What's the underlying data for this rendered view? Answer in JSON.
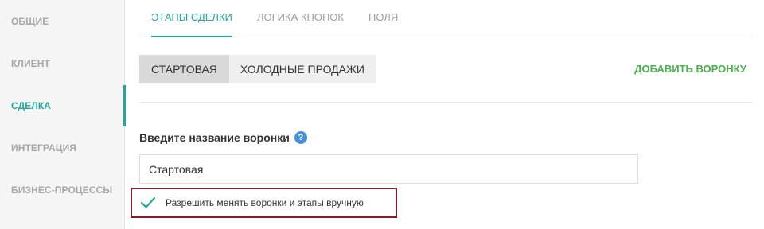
{
  "sidebar": {
    "items": [
      {
        "label": "ОБЩИЕ"
      },
      {
        "label": "КЛИЕНТ"
      },
      {
        "label": "СДЕЛКА"
      },
      {
        "label": "ИНТЕГРАЦИЯ"
      },
      {
        "label": "БИЗНЕС-ПРОЦЕССЫ"
      }
    ],
    "active": "СДЕЛКА"
  },
  "tabs": {
    "items": [
      {
        "label": "ЭТАПЫ СДЕЛКИ"
      },
      {
        "label": "ЛОГИКА КНОПОК"
      },
      {
        "label": "ПОЛЯ"
      }
    ],
    "active": "ЭТАПЫ СДЕЛКИ"
  },
  "funnels": {
    "items": [
      {
        "label": "СТАРТОВАЯ"
      },
      {
        "label": "ХОЛОДНЫЕ ПРОДАЖИ"
      }
    ],
    "active": "СТАРТОВАЯ",
    "add_label": "ДОБАВИТЬ ВОРОНКУ"
  },
  "form": {
    "name_label": "Введите название воронки",
    "help_icon": "question-circle-icon",
    "name_value": "Стартовая",
    "checkbox_label": "Разрешить менять воронки и этапы вручную",
    "checkbox_checked": true
  },
  "colors": {
    "accent": "#26a69a",
    "add_button": "#4caf50",
    "highlight_border": "#8b1a2b",
    "help_icon": "#4a90d9"
  }
}
